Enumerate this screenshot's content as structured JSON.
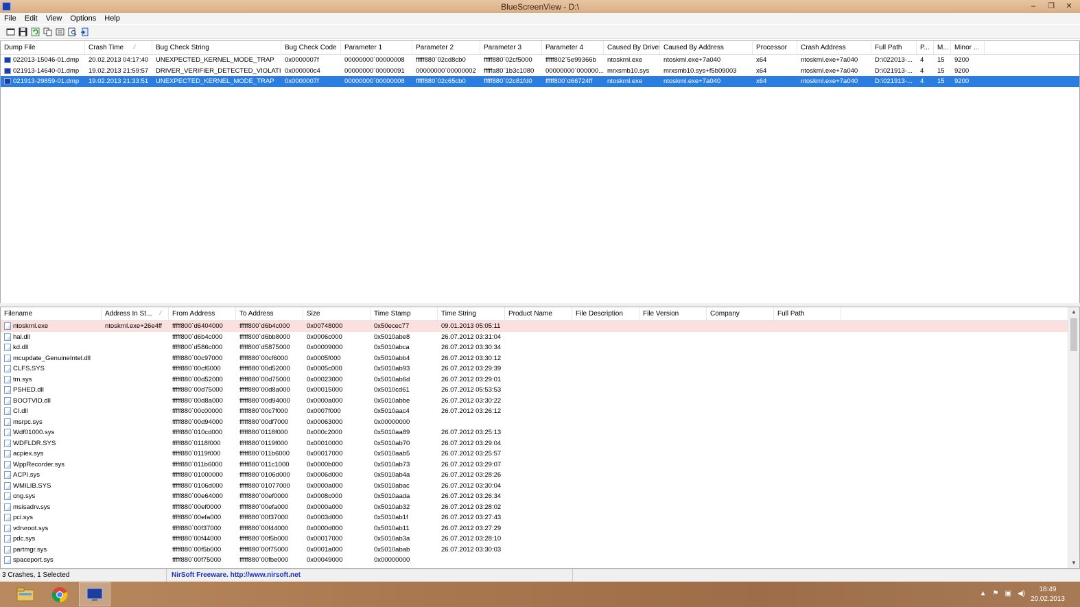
{
  "window": {
    "title": "BlueScreenView  -  D:\\",
    "minimize": "–",
    "restore": "❐",
    "close": "✕"
  },
  "menu": [
    "File",
    "Edit",
    "View",
    "Options",
    "Help"
  ],
  "toolbar": [
    "new-icon",
    "save-icon",
    "refresh-icon",
    "copy-icon",
    "properties-icon",
    "find-icon",
    "exit-icon"
  ],
  "upper": {
    "columns": [
      {
        "label": "Dump File",
        "w": 123
      },
      {
        "label": "Crash Time",
        "w": 98
      },
      {
        "label": "Bug Check String",
        "w": 188
      },
      {
        "label": "Bug Check Code",
        "w": 87
      },
      {
        "label": "Parameter 1",
        "w": 104
      },
      {
        "label": "Parameter 2",
        "w": 99
      },
      {
        "label": "Parameter 3",
        "w": 90
      },
      {
        "label": "Parameter 4",
        "w": 90
      },
      {
        "label": "Caused By Driver",
        "w": 82
      },
      {
        "label": "Caused By Address",
        "w": 135
      },
      {
        "label": "Processor",
        "w": 65
      },
      {
        "label": "Crash Address",
        "w": 108
      },
      {
        "label": "Full Path",
        "w": 66
      },
      {
        "label": "P...",
        "w": 25
      },
      {
        "label": "M...",
        "w": 25
      },
      {
        "label": "Minor ...",
        "w": 49
      }
    ],
    "rows": [
      [
        "022013-15046-01.dmp",
        "20.02.2013 04:17:40",
        "UNEXPECTED_KERNEL_MODE_TRAP",
        "0x0000007f",
        "00000000`00000008",
        "fffff880`02cd8cb0",
        "fffff880`02cf5000",
        "fffff802`5e99366b",
        "ntoskrnl.exe",
        "ntoskrnl.exe+7a040",
        "x64",
        "ntoskrnl.exe+7a040",
        "D:\\022013-...",
        "4",
        "15",
        "9200"
      ],
      [
        "021913-14640-01.dmp",
        "19.02.2013 21:59:57",
        "DRIVER_VERIFIER_DETECTED_VIOLATION",
        "0x000000c4",
        "00000000`00000091",
        "00000000`00000002",
        "fffffa80`1b3c1080",
        "00000000`000000...",
        "mrxsmb10.sys",
        "mrxsmb10.sys+f5b09003",
        "x64",
        "ntoskrnl.exe+7a040",
        "D:\\021913-...",
        "4",
        "15",
        "9200"
      ],
      [
        "021913-29859-01.dmp",
        "19.02.2013 21:33:51",
        "UNEXPECTED_KERNEL_MODE_TRAP",
        "0x0000007f",
        "00000000`00000008",
        "fffff880`02c65cb0",
        "fffff880`02c81fd0",
        "fffff800`d66724ff",
        "ntoskrnl.exe",
        "ntoskrnl.exe+7a040",
        "x64",
        "ntoskrnl.exe+7a040",
        "D:\\021913-...",
        "4",
        "15",
        "9200"
      ]
    ],
    "selected_index": 2
  },
  "lower": {
    "columns": [
      {
        "label": "Filename",
        "w": 147
      },
      {
        "label": "Address In St...",
        "w": 98
      },
      {
        "label": "From Address",
        "w": 98
      },
      {
        "label": "To Address",
        "w": 98
      },
      {
        "label": "Size",
        "w": 98
      },
      {
        "label": "Time Stamp",
        "w": 98
      },
      {
        "label": "Time String",
        "w": 98
      },
      {
        "label": "Product Name",
        "w": 98
      },
      {
        "label": "File Description",
        "w": 98
      },
      {
        "label": "File Version",
        "w": 98
      },
      {
        "label": "Company",
        "w": 98
      },
      {
        "label": "Full Path",
        "w": 98
      }
    ],
    "rows": [
      [
        "ntoskrnl.exe",
        "ntoskrnl.exe+26e4ff",
        "fffff800`d6404000",
        "fffff800`d6b4c000",
        "0x00748000",
        "0x50ecec77",
        "09.01.2013 05:05:11",
        "",
        "",
        "",
        "",
        ""
      ],
      [
        "hal.dll",
        "",
        "fffff800`d6b4c000",
        "fffff800`d6bb8000",
        "0x0006c000",
        "0x5010abe8",
        "26.07.2012 03:31:04",
        "",
        "",
        "",
        "",
        ""
      ],
      [
        "kd.dll",
        "",
        "fffff800`d586c000",
        "fffff800`d5875000",
        "0x00009000",
        "0x5010abca",
        "26.07.2012 03:30:34",
        "",
        "",
        "",
        "",
        ""
      ],
      [
        "mcupdate_GenuineIntel.dll",
        "",
        "fffff880`00c97000",
        "fffff880`00cf6000",
        "0x0005f000",
        "0x5010abb4",
        "26.07.2012 03:30:12",
        "",
        "",
        "",
        "",
        ""
      ],
      [
        "CLFS.SYS",
        "",
        "fffff880`00cf6000",
        "fffff880`00d52000",
        "0x0005c000",
        "0x5010ab93",
        "26.07.2012 03:29:39",
        "",
        "",
        "",
        "",
        ""
      ],
      [
        "tm.sys",
        "",
        "fffff880`00d52000",
        "fffff880`00d75000",
        "0x00023000",
        "0x5010ab6d",
        "26.07.2012 03:29:01",
        "",
        "",
        "",
        "",
        ""
      ],
      [
        "PSHED.dll",
        "",
        "fffff880`00d75000",
        "fffff880`00d8a000",
        "0x00015000",
        "0x5010cd61",
        "26.07.2012 05:53:53",
        "",
        "",
        "",
        "",
        ""
      ],
      [
        "BOOTVID.dll",
        "",
        "fffff880`00d8a000",
        "fffff880`00d94000",
        "0x0000a000",
        "0x5010abbe",
        "26.07.2012 03:30:22",
        "",
        "",
        "",
        "",
        ""
      ],
      [
        "CI.dll",
        "",
        "fffff880`00c00000",
        "fffff880`00c7f000",
        "0x0007f000",
        "0x5010aac4",
        "26.07.2012 03:26:12",
        "",
        "",
        "",
        "",
        ""
      ],
      [
        "msrpc.sys",
        "",
        "fffff880`00d94000",
        "fffff880`00df7000",
        "0x00063000",
        "0x00000000",
        "",
        "",
        "",
        "",
        "",
        ""
      ],
      [
        "Wdf01000.sys",
        "",
        "fffff880`010cd000",
        "fffff880`0118f000",
        "0x000c2000",
        "0x5010aa89",
        "26.07.2012 03:25:13",
        "",
        "",
        "",
        "",
        ""
      ],
      [
        "WDFLDR.SYS",
        "",
        "fffff880`0118f000",
        "fffff880`0119f000",
        "0x00010000",
        "0x5010ab70",
        "26.07.2012 03:29:04",
        "",
        "",
        "",
        "",
        ""
      ],
      [
        "acpiex.sys",
        "",
        "fffff880`0119f000",
        "fffff880`011b6000",
        "0x00017000",
        "0x5010aab5",
        "26.07.2012 03:25:57",
        "",
        "",
        "",
        "",
        ""
      ],
      [
        "WppRecorder.sys",
        "",
        "fffff880`011b6000",
        "fffff880`011c1000",
        "0x0000b000",
        "0x5010ab73",
        "26.07.2012 03:29:07",
        "",
        "",
        "",
        "",
        ""
      ],
      [
        "ACPI.sys",
        "",
        "fffff880`01000000",
        "fffff880`0106d000",
        "0x0006d000",
        "0x5010ab4a",
        "26.07.2012 03:28:26",
        "",
        "",
        "",
        "",
        ""
      ],
      [
        "WMILIB.SYS",
        "",
        "fffff880`0106d000",
        "fffff880`01077000",
        "0x0000a000",
        "0x5010abac",
        "26.07.2012 03:30:04",
        "",
        "",
        "",
        "",
        ""
      ],
      [
        "cng.sys",
        "",
        "fffff880`00e64000",
        "fffff880`00ef0000",
        "0x0008c000",
        "0x5010aada",
        "26.07.2012 03:26:34",
        "",
        "",
        "",
        "",
        ""
      ],
      [
        "msisadrv.sys",
        "",
        "fffff880`00ef0000",
        "fffff880`00efa000",
        "0x0000a000",
        "0x5010ab32",
        "26.07.2012 03:28:02",
        "",
        "",
        "",
        "",
        ""
      ],
      [
        "pci.sys",
        "",
        "fffff880`00efa000",
        "fffff880`00f37000",
        "0x0003d000",
        "0x5010ab1f",
        "26.07.2012 03:27:43",
        "",
        "",
        "",
        "",
        ""
      ],
      [
        "vdrvroot.sys",
        "",
        "fffff880`00f37000",
        "fffff880`00f44000",
        "0x0000d000",
        "0x5010ab11",
        "26.07.2012 03:27:29",
        "",
        "",
        "",
        "",
        ""
      ],
      [
        "pdc.sys",
        "",
        "fffff880`00f44000",
        "fffff880`00f5b000",
        "0x00017000",
        "0x5010ab3a",
        "26.07.2012 03:28:10",
        "",
        "",
        "",
        "",
        ""
      ],
      [
        "partmgr.sys",
        "",
        "fffff880`00f5b000",
        "fffff880`00f75000",
        "0x0001a000",
        "0x5010abab",
        "26.07.2012 03:30:03",
        "",
        "",
        "",
        "",
        ""
      ],
      [
        "spaceport.sys",
        "",
        "fffff880`00f75000",
        "fffff880`00fbe000",
        "0x00049000",
        "0x00000000",
        "",
        "",
        "",
        "",
        "",
        ""
      ]
    ],
    "highlight_index": 0
  },
  "status": {
    "count": "3 Crashes, 1 Selected",
    "link": "NirSoft Freeware.  http://www.nirsoft.net"
  },
  "taskbar": {
    "apps": [
      "explorer-icon",
      "chrome-icon",
      "bluescreenview-icon"
    ],
    "tray": [
      "▲",
      "⚑",
      "▣",
      "◀)"
    ],
    "time": "18:49",
    "date": "20.02.2013"
  },
  "colors": {
    "selection": "#2a7de1",
    "highlight_row": "#fbe0e0",
    "link": "#1a2fb8"
  }
}
